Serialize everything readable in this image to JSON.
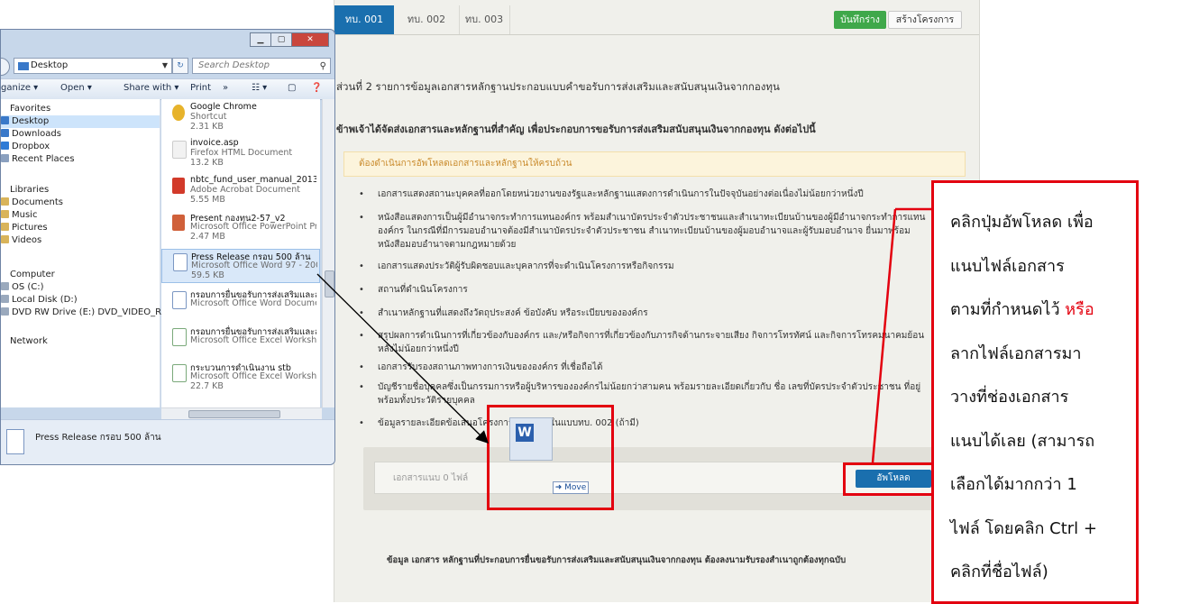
{
  "webpage": {
    "tabs": [
      {
        "label": "ทบ. 001",
        "active": true
      },
      {
        "label": "ทบ. 002",
        "active": false
      },
      {
        "label": "ทบ. 003",
        "active": false
      }
    ],
    "save_draft_label": "บันทึกร่าง",
    "create_project_label": "สร้างโครงการ",
    "section_title": "ส่วนที่ 2 รายการข้อมูลเอกสารหลักฐานประกอบแบบคำขอรับการส่งเสริมและสนับสนุนเงินจากกองทุน",
    "intro": "ข้าพเจ้าได้จัดส่งเอกสารและหลักฐานที่สำคัญ เพื่อประกอบการขอรับการส่งเสริมสนับสนุนเงินจากกองทุน ดังต่อไปนี้",
    "alert": "ต้องดำเนินการอัพโหลดเอกสารและหลักฐานให้ครบถ้วน",
    "documents": [
      "เอกสารแสดงสถานะบุคคลที่ออกโดยหน่วยงานของรัฐและหลักฐานแสดงการดำเนินการในปัจจุบันอย่างต่อเนื่องไม่น้อยกว่าหนึ่งปี",
      "หนังสือแสดงการเป็นผู้มีอำนาจกระทำการแทนองค์กร พร้อมสำเนาบัตรประจำตัวประชาชนและสำเนาทะเบียนบ้านของผู้มีอำนาจกระทำการแทนองค์กร ในกรณีที่มีการมอบอำนาจต้องมีสำเนาบัตรประจำตัวประชาชน สำเนาทะเบียนบ้านของผู้มอบอำนาจและผู้รับมอบอำนาจ ยื่นมาพร้อมหนังสือมอบอำนาจตามกฎหมายด้วย",
      "เอกสารแสดงประวัติผู้รับผิดชอบและบุคลากรที่จะดำเนินโครงการหรือกิจกรรม",
      "สถานที่ดำเนินโครงการ",
      "สำเนาหลักฐานที่แสดงถึงวัตถุประสงค์ ข้อบังคับ หรือระเบียบขององค์กร",
      "สรุปผลการดำเนินการที่เกี่ยวข้องกับองค์กร และ/หรือกิจการที่เกี่ยวข้องกับภารกิจด้านกระจายเสียง กิจการโทรทัศน์ และกิจการโทรคมนาคมย้อนหลังไม่น้อยกว่าหนึ่งปี",
      "เอกสารรับรองสถานภาพทางการเงินขององค์กร ที่เชื่อถือได้",
      "บัญชีรายชื่อบุคคลซึ่งเป็นกรรมการหรือผู้บริหารขององค์กรไม่น้อยกว่าสามคน พร้อมรายละเอียดเกี่ยวกับ ชื่อ เลขที่บัตรประจำตัวประชาชน ที่อยู่ พร้อมทั้งประวัติรายบุคคล",
      "ข้อมูลรายละเอียดข้อเสนอโครงการ ตามแบบในแบบทบ. 002 (ถ้ามี)"
    ],
    "attachments_label": "เอกสารแนบ 0 ไฟล์",
    "upload_label": "อัพโหลด",
    "footer_note": "ข้อมูล เอกสาร หลักฐานที่ประกอบการยื่นขอรับการส่งเสริมและสนับสนุนเงินจากกองทุน ต้องลงนามรับรองสำเนาถูกต้องทุกฉบับ"
  },
  "explorer": {
    "address": "Desktop",
    "search_placeholder": "Search Desktop",
    "commands": [
      "ganize ▾",
      "Open ▾",
      "Share with ▾",
      "Print",
      "»"
    ],
    "nav": [
      {
        "label": "Favorites",
        "selected": false,
        "icon_color": "#e8c25a"
      },
      {
        "label": "Desktop",
        "selected": true,
        "icon_color": "#3a79c9"
      },
      {
        "label": "Downloads",
        "selected": false,
        "icon_color": "#3a79c9"
      },
      {
        "label": "Dropbox",
        "selected": false,
        "icon_color": "#2f7bd6"
      },
      {
        "label": "Recent Places",
        "selected": false,
        "icon_color": "#8aa0bf"
      },
      {
        "label": "Libraries",
        "selected": false,
        "icon_color": "#d9b45a"
      },
      {
        "label": "Documents",
        "selected": false,
        "icon_color": "#d9b45a"
      },
      {
        "label": "Music",
        "selected": false,
        "icon_color": "#d9b45a"
      },
      {
        "label": "Pictures",
        "selected": false,
        "icon_color": "#d9b45a"
      },
      {
        "label": "Videos",
        "selected": false,
        "icon_color": "#d9b45a"
      },
      {
        "label": "Computer",
        "selected": false,
        "icon_color": "#7b8ea8"
      },
      {
        "label": "OS (C:)",
        "selected": false,
        "icon_color": "#9aa9bd"
      },
      {
        "label": "Local Disk (D:)",
        "selected": false,
        "icon_color": "#9aa9bd"
      },
      {
        "label": "DVD RW Drive (E:) DVD_VIDEO_RECORDER",
        "selected": false,
        "icon_color": "#9aa9bd"
      },
      {
        "label": "Network",
        "selected": false,
        "icon_color": "#5f83b6"
      }
    ],
    "files": [
      {
        "name": "Google Chrome",
        "type": "Shortcut",
        "size": "2.31 KB",
        "icon_color": "#e7b32b",
        "selected": false
      },
      {
        "name": "invoice.asp",
        "type": "Firefox HTML Document",
        "size": "13.2 KB",
        "icon_color": "#f2f2f2",
        "selected": false
      },
      {
        "name": "nbtc_fund_user_manual_20130930",
        "type": "Adobe Acrobat Document",
        "size": "5.55 MB",
        "icon_color": "#d23a2a",
        "selected": false
      },
      {
        "name": "Present กองทุน2-57_v2",
        "type": "Microsoft Office PowerPoint Pres...",
        "size": "2.47 MB",
        "icon_color": "#d0603a",
        "selected": false
      },
      {
        "name": "Press Release กรอบ 500 ล้าน",
        "type": "Microsoft Office Word 97 - 2003 ...",
        "size": "59.5 KB",
        "icon_color": "#ffffff",
        "selected": true
      },
      {
        "name": "กรอบการยื่นขอรับการส่งเสริมและสนับสนุน ปี 57",
        "type": "Microsoft Office Word Document",
        "size": "",
        "icon_color": "#ffffff",
        "selected": false
      },
      {
        "name": "กรอบการยื่นขอรับการส่งเสริมและสนับสนุน",
        "type": "Microsoft Office Excel Worksheet",
        "size": "",
        "icon_color": "#ffffff",
        "selected": false
      },
      {
        "name": "กระบวนการดำเนินงาน stb",
        "type": "Microsoft Office Excel Worksheet",
        "size": "22.7 KB",
        "icon_color": "#ffffff",
        "selected": false
      }
    ],
    "details_name": "Press Release กรอบ 500 ล้าน"
  },
  "drag": {
    "move_label": "Move"
  },
  "callout": {
    "lines": [
      {
        "text": "คลิกปุ่มอัพโหลด เพื่อ",
        "highlight": ""
      },
      {
        "text": "แนบไฟล์เอกสาร",
        "highlight": ""
      },
      {
        "text": "ตามที่กำหนดไว้ ",
        "highlight": "หรือ"
      },
      {
        "text": "ลากไฟล์เอกสารมา",
        "highlight": ""
      },
      {
        "text": "วางที่ช่องเอกสาร",
        "highlight": ""
      },
      {
        "text": "แนบได้เลย (สามารถ",
        "highlight": ""
      },
      {
        "text": "เลือกได้มากกว่า 1",
        "highlight": ""
      },
      {
        "text": "ไฟล์ โดยคลิก Ctrl +",
        "highlight": ""
      },
      {
        "text": "คลิกที่ชื่อไฟล์)",
        "highlight": ""
      }
    ]
  },
  "colors": {
    "accent_blue": "#1a6fae",
    "draft_green": "#3fa84a",
    "annotation_red": "#e3000f"
  }
}
